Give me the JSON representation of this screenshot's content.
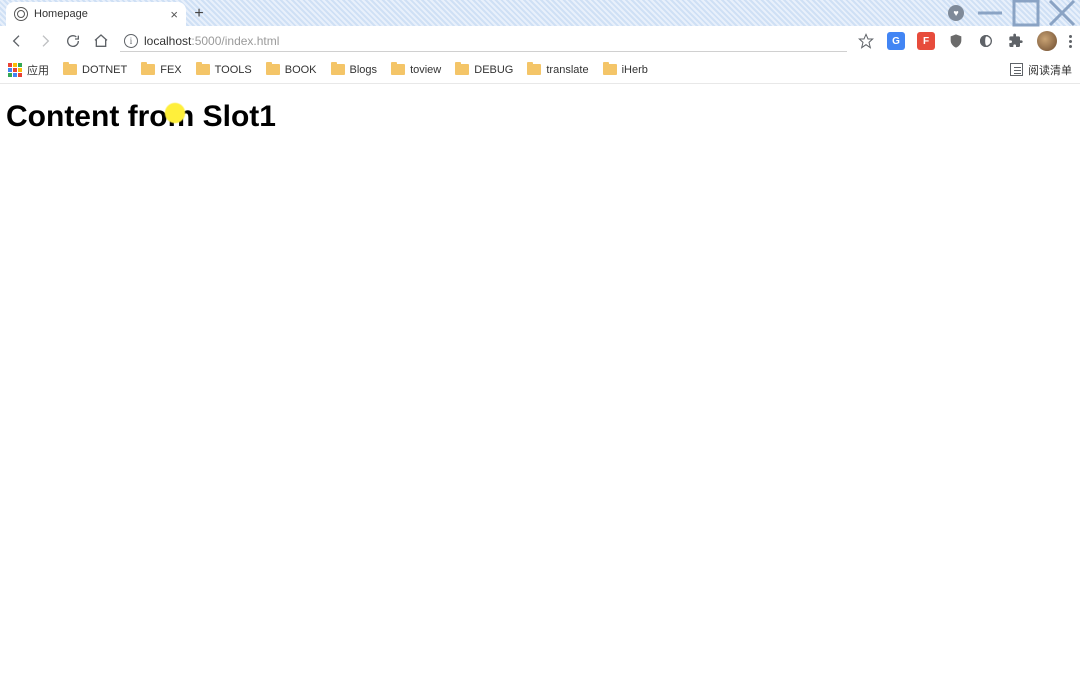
{
  "tab": {
    "title": "Homepage"
  },
  "address": {
    "host": "localhost",
    "port_path": ":5000/index.html"
  },
  "bookmarks": {
    "apps_label": "应用",
    "items": [
      {
        "label": "DOTNET"
      },
      {
        "label": "FEX"
      },
      {
        "label": "TOOLS"
      },
      {
        "label": "BOOK"
      },
      {
        "label": "Blogs"
      },
      {
        "label": "toview"
      },
      {
        "label": "DEBUG"
      },
      {
        "label": "translate"
      },
      {
        "label": "iHerb"
      }
    ],
    "reading_list": "阅读清单"
  },
  "page": {
    "heading": "Content from Slot1"
  }
}
